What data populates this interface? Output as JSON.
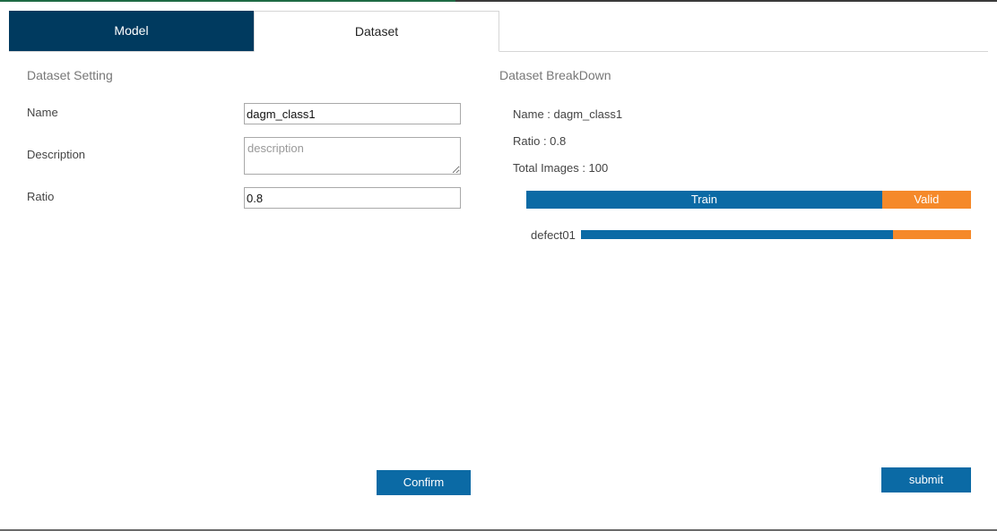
{
  "tabs": {
    "model_label": "Model",
    "dataset_label": "Dataset"
  },
  "dataset_setting": {
    "title": "Dataset Setting",
    "name_label": "Name",
    "name_value": "dagm_class1",
    "description_label": "Description",
    "description_value": "",
    "description_placeholder": "description",
    "ratio_label": "Ratio",
    "ratio_value": "0.8",
    "confirm_label": "Confirm"
  },
  "breakdown": {
    "title": "Dataset BreakDown",
    "name_line": "Name : dagm_class1",
    "ratio_line": "Ratio : 0.8",
    "total_line": "Total Images : 100",
    "split": {
      "train_label": "Train",
      "valid_label": "Valid",
      "train_fraction": 0.8
    },
    "classes": [
      {
        "name": "defect01",
        "train_fraction": 0.8
      }
    ],
    "submit_label": "submit"
  },
  "colors": {
    "tab_active_bg": "#003a5f",
    "train": "#0b6aa5",
    "valid": "#f5892a",
    "button": "#0b6aa5"
  }
}
